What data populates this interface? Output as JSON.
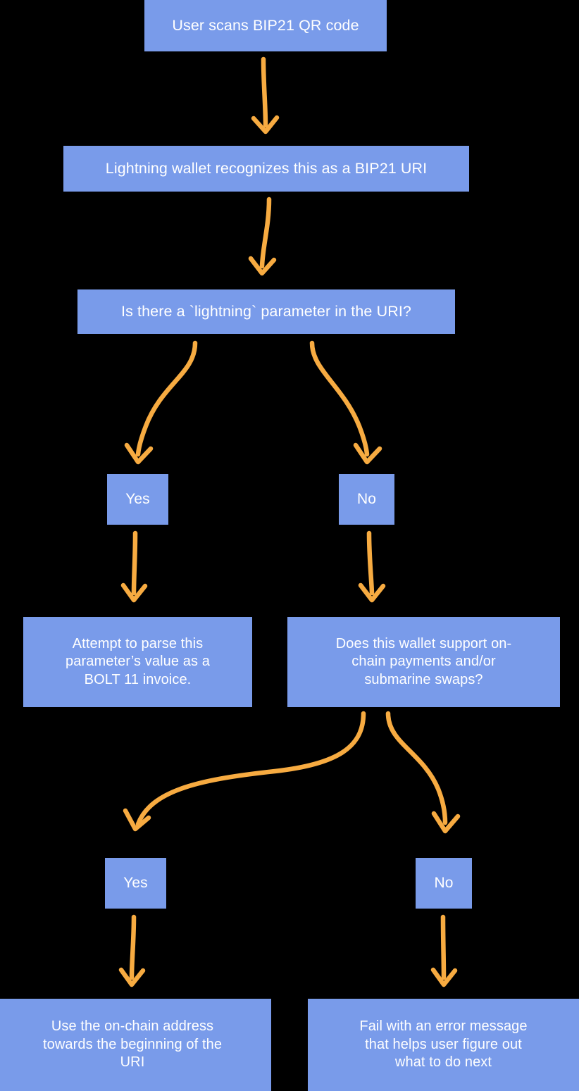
{
  "diagram": {
    "title": "BIP21 QR code handling flow for Lightning wallets",
    "background_color": "#000000",
    "node_color": "#799BEA",
    "node_text_color": "#FFFFFF",
    "arrow_color": "#F7AB41",
    "type": "flowchart"
  },
  "nodes": {
    "scan": "User scans BIP21 QR code",
    "recognize": "Lightning wallet recognizes this as a BIP21 URI",
    "question": "Is there a `lightning` parameter in the URI?",
    "yes1": "Yes",
    "no1": "No",
    "parse": "Attempt to parse this\nparameter’s value as a\nBOLT 11 invoice.",
    "support": "Does this wallet support on-\nchain payments and/or\nsubmarine swaps?",
    "yes2": "Yes",
    "no2": "No",
    "onchain": "Use the on-chain address\ntowards the beginning of the\nURI",
    "fail": "Fail with an error message\nthat helps user figure out\nwhat to do next"
  },
  "edges": [
    {
      "id": "e-scan-recognize",
      "from": "scan",
      "to": "recognize",
      "label": ""
    },
    {
      "id": "e-recognize-question",
      "from": "recognize",
      "to": "question",
      "label": ""
    },
    {
      "id": "e-question-yes",
      "from": "question",
      "to": "yes1",
      "label": ""
    },
    {
      "id": "e-question-no",
      "from": "question",
      "to": "no1",
      "label": ""
    },
    {
      "id": "e-yes1-parse",
      "from": "yes1",
      "to": "parse",
      "label": ""
    },
    {
      "id": "e-no1-support",
      "from": "no1",
      "to": "support",
      "label": ""
    },
    {
      "id": "e-support-yes",
      "from": "support",
      "to": "yes2",
      "label": ""
    },
    {
      "id": "e-support-no",
      "from": "support",
      "to": "no2",
      "label": ""
    },
    {
      "id": "e-yes2-onchain",
      "from": "yes2",
      "to": "onchain",
      "label": ""
    },
    {
      "id": "e-no2-fail",
      "from": "no2",
      "to": "fail",
      "label": ""
    }
  ]
}
